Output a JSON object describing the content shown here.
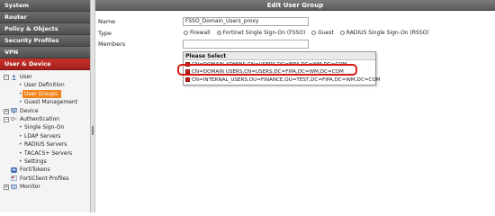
{
  "nav": {
    "system": "System",
    "router": "Router",
    "policy": "Policy & Objects",
    "security": "Security Profiles",
    "vpn": "VPN",
    "user_device": "User & Device"
  },
  "tree": {
    "user": "User",
    "user_definition": "User Definition",
    "user_groups": "User Groups",
    "guest_management": "Guest Management",
    "device": "Device",
    "authentication": "Authentication",
    "single_sign_on": "Single Sign-On",
    "ldap_servers": "LDAP Servers",
    "radius_servers": "RADIUS Servers",
    "tacacs_servers": "TACACS+ Servers",
    "settings": "Settings",
    "fortitokens": "FortiTokens",
    "forticlient_profiles": "FortiClient Profiles",
    "monitor": "Monitor"
  },
  "form": {
    "title": "Edit User Group",
    "name_label": "Name",
    "name_value": "FSSO_Domain_Users_proxy",
    "type_label": "Type",
    "type_options": [
      "Firewall",
      "Fortinet Single Sign-On (FSSO)",
      "Guest",
      "RADIUS Single Sign-On (RSSO)"
    ],
    "type_selected": "Fortinet Single Sign-On (FSSO)",
    "members_label": "Members"
  },
  "popup": {
    "header": "Please Select",
    "options": [
      "CN=DOMAIN ADMINS,CN=USERS,DC=FIPA,DC=WM,DC=COM",
      "CN=DOMAIN USERS,CN=USERS,DC=FIPA,DC=WM,DC=COM",
      "CN=INTERNAL_USERS,OU=FINANCE,OU=TEST,DC=FIPA,DC=WM,DC=COM"
    ],
    "checked_index": 1
  },
  "colors": {
    "active_nav": "#b3241d",
    "selected_tree": "#f0841d",
    "highlight": "#d71a14"
  }
}
